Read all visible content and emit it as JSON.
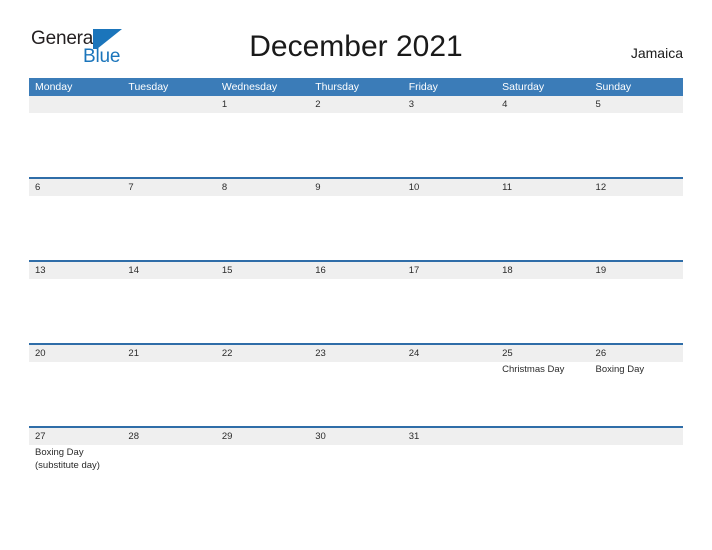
{
  "brand": {
    "name_part1": "General",
    "name_part2": "Blue",
    "logo_icon": "flag-triangle-icon",
    "accent_color": "#1b75bb"
  },
  "header": {
    "title": "December 2021",
    "region": "Jamaica"
  },
  "calendar": {
    "header_bg": "#3b7cb8",
    "row_divider_color": "#2f6da8",
    "daystrip_bg": "#efefef",
    "weekdays": [
      "Monday",
      "Tuesday",
      "Wednesday",
      "Thursday",
      "Friday",
      "Saturday",
      "Sunday"
    ],
    "weeks": [
      {
        "days": [
          {
            "num": "",
            "events": []
          },
          {
            "num": "",
            "events": []
          },
          {
            "num": "1",
            "events": []
          },
          {
            "num": "2",
            "events": []
          },
          {
            "num": "3",
            "events": []
          },
          {
            "num": "4",
            "events": []
          },
          {
            "num": "5",
            "events": []
          }
        ]
      },
      {
        "days": [
          {
            "num": "6",
            "events": []
          },
          {
            "num": "7",
            "events": []
          },
          {
            "num": "8",
            "events": []
          },
          {
            "num": "9",
            "events": []
          },
          {
            "num": "10",
            "events": []
          },
          {
            "num": "11",
            "events": []
          },
          {
            "num": "12",
            "events": []
          }
        ]
      },
      {
        "days": [
          {
            "num": "13",
            "events": []
          },
          {
            "num": "14",
            "events": []
          },
          {
            "num": "15",
            "events": []
          },
          {
            "num": "16",
            "events": []
          },
          {
            "num": "17",
            "events": []
          },
          {
            "num": "18",
            "events": []
          },
          {
            "num": "19",
            "events": []
          }
        ]
      },
      {
        "days": [
          {
            "num": "20",
            "events": []
          },
          {
            "num": "21",
            "events": []
          },
          {
            "num": "22",
            "events": []
          },
          {
            "num": "23",
            "events": []
          },
          {
            "num": "24",
            "events": []
          },
          {
            "num": "25",
            "events": [
              "Christmas Day"
            ]
          },
          {
            "num": "26",
            "events": [
              "Boxing Day"
            ]
          }
        ]
      },
      {
        "days": [
          {
            "num": "27",
            "events": [
              "Boxing Day",
              "(substitute day)"
            ]
          },
          {
            "num": "28",
            "events": []
          },
          {
            "num": "29",
            "events": []
          },
          {
            "num": "30",
            "events": []
          },
          {
            "num": "31",
            "events": []
          },
          {
            "num": "",
            "events": []
          },
          {
            "num": "",
            "events": []
          }
        ]
      }
    ]
  }
}
